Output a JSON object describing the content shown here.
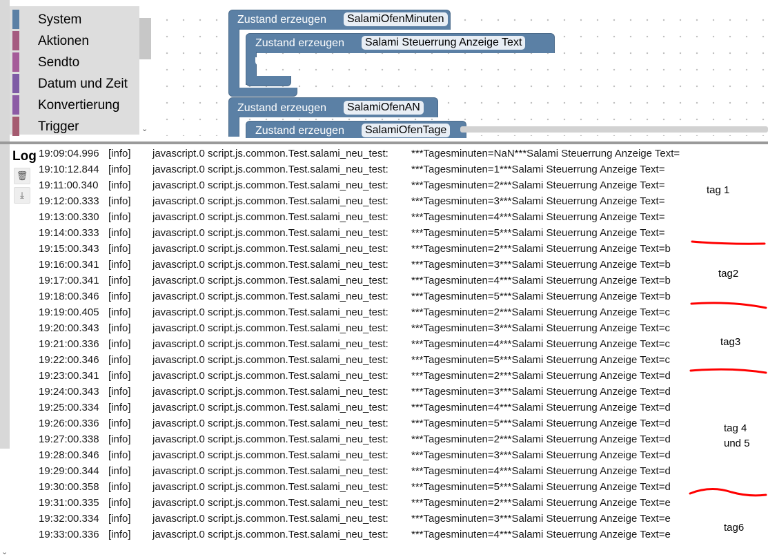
{
  "toolbox": {
    "items": [
      {
        "label": "System",
        "color": "#5b80a5"
      },
      {
        "label": "Aktionen",
        "color": "#a55b80"
      },
      {
        "label": "Sendto",
        "color": "#a55b99"
      },
      {
        "label": "Datum und Zeit",
        "color": "#7e5ba5"
      },
      {
        "label": "Konvertierung",
        "color": "#8c5ba5"
      },
      {
        "label": "Trigger",
        "color": "#a55b70"
      }
    ]
  },
  "blocks": [
    {
      "label": "Zustand erzeugen",
      "field": "SalamiOfenMinuten"
    },
    {
      "label": "Zustand erzeugen",
      "field": "Salami Steuerrung Anzeige Text"
    },
    {
      "label": "Zustand erzeugen",
      "field": "SalamiOfenAN"
    },
    {
      "label": "Zustand erzeugen",
      "field": "SalamiOfenTage"
    }
  ],
  "block_color": "#5b80a5",
  "log": {
    "title": "Log",
    "buttons": [
      {
        "icon": "trash-icon"
      },
      {
        "icon": "download-icon"
      }
    ],
    "rows": [
      {
        "time": "19:09:04.996",
        "severity": "[info]",
        "source": "javascript.0 script.js.common.Test.salami_neu_test:",
        "message": "***Tagesminuten=NaN***Salami Steuerrung Anzeige Text="
      },
      {
        "time": "19:10:12.844",
        "severity": "[info]",
        "source": "javascript.0 script.js.common.Test.salami_neu_test:",
        "message": "***Tagesminuten=1***Salami Steuerrung Anzeige Text="
      },
      {
        "time": "19:11:00.340",
        "severity": "[info]",
        "source": "javascript.0 script.js.common.Test.salami_neu_test:",
        "message": "***Tagesminuten=2***Salami Steuerrung Anzeige Text="
      },
      {
        "time": "19:12:00.333",
        "severity": "[info]",
        "source": "javascript.0 script.js.common.Test.salami_neu_test:",
        "message": "***Tagesminuten=3***Salami Steuerrung Anzeige Text="
      },
      {
        "time": "19:13:00.330",
        "severity": "[info]",
        "source": "javascript.0 script.js.common.Test.salami_neu_test:",
        "message": "***Tagesminuten=4***Salami Steuerrung Anzeige Text="
      },
      {
        "time": "19:14:00.333",
        "severity": "[info]",
        "source": "javascript.0 script.js.common.Test.salami_neu_test:",
        "message": "***Tagesminuten=5***Salami Steuerrung Anzeige Text="
      },
      {
        "time": "19:15:00.343",
        "severity": "[info]",
        "source": "javascript.0 script.js.common.Test.salami_neu_test:",
        "message": "***Tagesminuten=2***Salami Steuerrung Anzeige Text=b"
      },
      {
        "time": "19:16:00.341",
        "severity": "[info]",
        "source": "javascript.0 script.js.common.Test.salami_neu_test:",
        "message": "***Tagesminuten=3***Salami Steuerrung Anzeige Text=b"
      },
      {
        "time": "19:17:00.341",
        "severity": "[info]",
        "source": "javascript.0 script.js.common.Test.salami_neu_test:",
        "message": "***Tagesminuten=4***Salami Steuerrung Anzeige Text=b"
      },
      {
        "time": "19:18:00.346",
        "severity": "[info]",
        "source": "javascript.0 script.js.common.Test.salami_neu_test:",
        "message": "***Tagesminuten=5***Salami Steuerrung Anzeige Text=b"
      },
      {
        "time": "19:19:00.405",
        "severity": "[info]",
        "source": "javascript.0 script.js.common.Test.salami_neu_test:",
        "message": "***Tagesminuten=2***Salami Steuerrung Anzeige Text=c"
      },
      {
        "time": "19:20:00.343",
        "severity": "[info]",
        "source": "javascript.0 script.js.common.Test.salami_neu_test:",
        "message": "***Tagesminuten=3***Salami Steuerrung Anzeige Text=c"
      },
      {
        "time": "19:21:00.336",
        "severity": "[info]",
        "source": "javascript.0 script.js.common.Test.salami_neu_test:",
        "message": "***Tagesminuten=4***Salami Steuerrung Anzeige Text=c"
      },
      {
        "time": "19:22:00.346",
        "severity": "[info]",
        "source": "javascript.0 script.js.common.Test.salami_neu_test:",
        "message": "***Tagesminuten=5***Salami Steuerrung Anzeige Text=c"
      },
      {
        "time": "19:23:00.341",
        "severity": "[info]",
        "source": "javascript.0 script.js.common.Test.salami_neu_test:",
        "message": "***Tagesminuten=2***Salami Steuerrung Anzeige Text=d"
      },
      {
        "time": "19:24:00.343",
        "severity": "[info]",
        "source": "javascript.0 script.js.common.Test.salami_neu_test:",
        "message": "***Tagesminuten=3***Salami Steuerrung Anzeige Text=d"
      },
      {
        "time": "19:25:00.334",
        "severity": "[info]",
        "source": "javascript.0 script.js.common.Test.salami_neu_test:",
        "message": "***Tagesminuten=4***Salami Steuerrung Anzeige Text=d"
      },
      {
        "time": "19:26:00.336",
        "severity": "[info]",
        "source": "javascript.0 script.js.common.Test.salami_neu_test:",
        "message": "***Tagesminuten=5***Salami Steuerrung Anzeige Text=d"
      },
      {
        "time": "19:27:00.338",
        "severity": "[info]",
        "source": "javascript.0 script.js.common.Test.salami_neu_test:",
        "message": "***Tagesminuten=2***Salami Steuerrung Anzeige Text=d"
      },
      {
        "time": "19:28:00.346",
        "severity": "[info]",
        "source": "javascript.0 script.js.common.Test.salami_neu_test:",
        "message": "***Tagesminuten=3***Salami Steuerrung Anzeige Text=d"
      },
      {
        "time": "19:29:00.344",
        "severity": "[info]",
        "source": "javascript.0 script.js.common.Test.salami_neu_test:",
        "message": "***Tagesminuten=4***Salami Steuerrung Anzeige Text=d"
      },
      {
        "time": "19:30:00.358",
        "severity": "[info]",
        "source": "javascript.0 script.js.common.Test.salami_neu_test:",
        "message": "***Tagesminuten=5***Salami Steuerrung Anzeige Text=d"
      },
      {
        "time": "19:31:00.335",
        "severity": "[info]",
        "source": "javascript.0 script.js.common.Test.salami_neu_test:",
        "message": "***Tagesminuten=2***Salami Steuerrung Anzeige Text=e"
      },
      {
        "time": "19:32:00.334",
        "severity": "[info]",
        "source": "javascript.0 script.js.common.Test.salami_neu_test:",
        "message": "***Tagesminuten=3***Salami Steuerrung Anzeige Text=e"
      },
      {
        "time": "19:33:00.336",
        "severity": "[info]",
        "source": "javascript.0 script.js.common.Test.salami_neu_test:",
        "message": "***Tagesminuten=4***Salami Steuerrung Anzeige Text=e"
      }
    ]
  },
  "annotations": {
    "labels": [
      "tag 1",
      "tag2",
      "tag3",
      "tag 4",
      "und 5",
      "tag6"
    ],
    "line_color": "#ff0000"
  }
}
